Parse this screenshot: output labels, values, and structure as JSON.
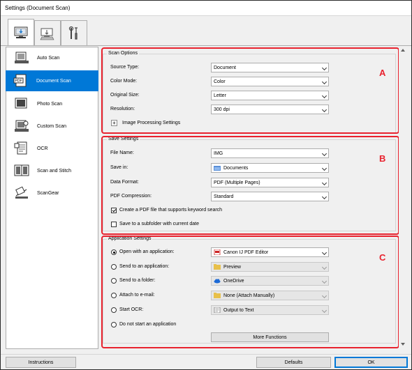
{
  "window": {
    "title": "Settings (Document Scan)"
  },
  "tabs": [
    {
      "icon": "computer-scan-icon"
    },
    {
      "icon": "computer-download-icon"
    },
    {
      "icon": "tools-icon"
    }
  ],
  "sidebar": {
    "items": [
      {
        "label": "Auto Scan",
        "icon": "auto-scan-icon"
      },
      {
        "label": "Document Scan",
        "icon": "pdf-document-icon",
        "selected": true
      },
      {
        "label": "Photo Scan",
        "icon": "photo-scan-icon"
      },
      {
        "label": "Custom Scan",
        "icon": "custom-scan-icon"
      },
      {
        "label": "OCR",
        "icon": "ocr-icon"
      },
      {
        "label": "Scan and Stitch",
        "icon": "scan-stitch-icon"
      },
      {
        "label": "ScanGear",
        "icon": "scangear-icon"
      }
    ]
  },
  "scan_options": {
    "title": "Scan Options",
    "source_type": {
      "label": "Source Type:",
      "value": "Document"
    },
    "color_mode": {
      "label": "Color Mode:",
      "value": "Color"
    },
    "original_size": {
      "label": "Original Size:",
      "value": "Letter"
    },
    "resolution": {
      "label": "Resolution:",
      "value": "300 dpi"
    },
    "image_processing": {
      "expander": "+",
      "label": "Image Processing Settings"
    }
  },
  "save_settings": {
    "title": "Save Settings",
    "file_name": {
      "label": "File Name:",
      "value": "IMG"
    },
    "save_in": {
      "label": "Save in:",
      "value": "Documents"
    },
    "data_format": {
      "label": "Data Format:",
      "value": "PDF (Multiple Pages)"
    },
    "pdf_compression": {
      "label": "PDF Compression:",
      "value": "Standard"
    },
    "keyword_search": {
      "label": "Create a PDF file that supports keyword search",
      "checked": true
    },
    "subfolder": {
      "label": "Save to a subfolder with current date",
      "checked": false
    }
  },
  "application_settings": {
    "title": "Application Settings",
    "options": [
      {
        "label": "Open with an application:",
        "value": "Canon IJ PDF Editor",
        "selected": true,
        "icon": "pdf-app-icon"
      },
      {
        "label": "Send to an application:",
        "value": "Preview",
        "selected": false,
        "icon": "folder-icon"
      },
      {
        "label": "Send to a folder:",
        "value": "OneDrive",
        "selected": false,
        "icon": "cloud-icon"
      },
      {
        "label": "Attach to e-mail:",
        "value": "None (Attach Manually)",
        "selected": false,
        "icon": "folder-icon"
      },
      {
        "label": "Start OCR:",
        "value": "Output to Text",
        "selected": false,
        "icon": "text-icon"
      },
      {
        "label": "Do not start an application",
        "selected": false
      }
    ],
    "more_functions": "More Functions"
  },
  "annotations": {
    "a": "A",
    "b": "B",
    "c": "C"
  },
  "footer": {
    "instructions": "Instructions",
    "defaults": "Defaults",
    "ok": "OK"
  },
  "colors": {
    "accent": "#0078d7",
    "annotation_red": "#e8222e"
  }
}
